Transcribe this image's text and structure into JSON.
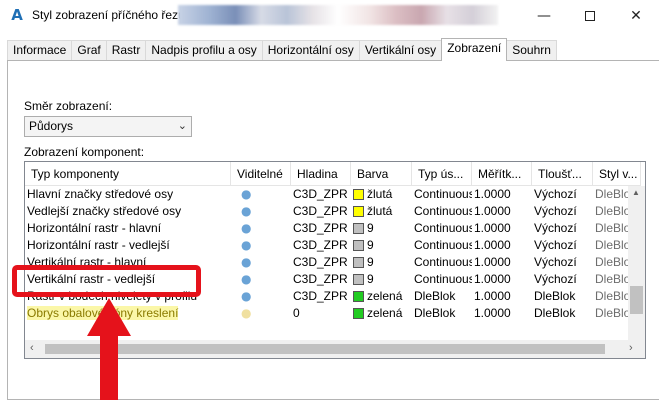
{
  "window": {
    "title": "Styl zobrazení příčného řezu",
    "min_glyph": "—",
    "max_glyph": "",
    "close_glyph": "✕"
  },
  "tabs": [
    "Informace",
    "Graf",
    "Rastr",
    "Nadpis profilu a osy",
    "Horizontální osy",
    "Vertikální osy",
    "Zobrazení",
    "Souhrn"
  ],
  "active_tab": "Zobrazení",
  "view_direction": {
    "label": "Směr zobrazení:",
    "value": "Půdorys"
  },
  "components": {
    "label": "Zobrazení komponent:",
    "columns": [
      "Typ komponenty",
      "Viditelné",
      "Hladina",
      "Barva",
      "Typ ús...",
      "Měřítk...",
      "Tloušť...",
      "Styl v..."
    ],
    "rows": [
      {
        "name": "Hlavní značky středové osy",
        "visible": true,
        "layer": "C3D_ZPR",
        "color_hex": "#ffff00",
        "color": "žlutá",
        "linetype": "Continuous",
        "scale": "1.0000",
        "weight": "Výchozí",
        "plotstyle": "DleBlok"
      },
      {
        "name": "Vedlejší značky středové osy",
        "visible": true,
        "layer": "C3D_ZPR",
        "color_hex": "#ffff00",
        "color": "žlutá",
        "linetype": "Continuous",
        "scale": "1.0000",
        "weight": "Výchozí",
        "plotstyle": "DleBlok"
      },
      {
        "name": "Horizontální rastr - hlavní",
        "visible": true,
        "layer": "C3D_ZPR",
        "color_hex": "#c0c0c0",
        "color": "9",
        "linetype": "Continuous",
        "scale": "1.0000",
        "weight": "Výchozí",
        "plotstyle": "DleBlok"
      },
      {
        "name": "Horizontální rastr - vedlejší",
        "visible": true,
        "layer": "C3D_ZPR",
        "color_hex": "#c0c0c0",
        "color": "9",
        "linetype": "Continuous",
        "scale": "1.0000",
        "weight": "Výchozí",
        "plotstyle": "DleBlok"
      },
      {
        "name": "Vertikální rastr - hlavní",
        "visible": true,
        "layer": "C3D_ZPR",
        "color_hex": "#c0c0c0",
        "color": "9",
        "linetype": "Continuous",
        "scale": "1.0000",
        "weight": "Výchozí",
        "plotstyle": "DleBlok"
      },
      {
        "name": "Vertikální rastr - vedlejší",
        "visible": true,
        "layer": "C3D_ZPR",
        "color_hex": "#c0c0c0",
        "color": "9",
        "linetype": "Continuous",
        "scale": "1.0000",
        "weight": "Výchozí",
        "plotstyle": "DleBlok"
      },
      {
        "name": "Rastr v bodech nivelety v profilu",
        "visible": true,
        "layer": "C3D_ZPR",
        "color_hex": "#22cc22",
        "color": "zelená",
        "linetype": "DleBlok",
        "scale": "1.0000",
        "weight": "DleBlok",
        "plotstyle": "DleBlok"
      },
      {
        "name": "Obrys obalové zóny kreslení",
        "visible": false,
        "layer": "0",
        "color_hex": "#22cc22",
        "color": "zelená",
        "linetype": "DleBlok",
        "scale": "1.0000",
        "weight": "DleBlok",
        "plotstyle": "DleBlok"
      }
    ]
  },
  "colors": {
    "annotation": "#e5121b",
    "highlight": "#fbf7a8"
  }
}
